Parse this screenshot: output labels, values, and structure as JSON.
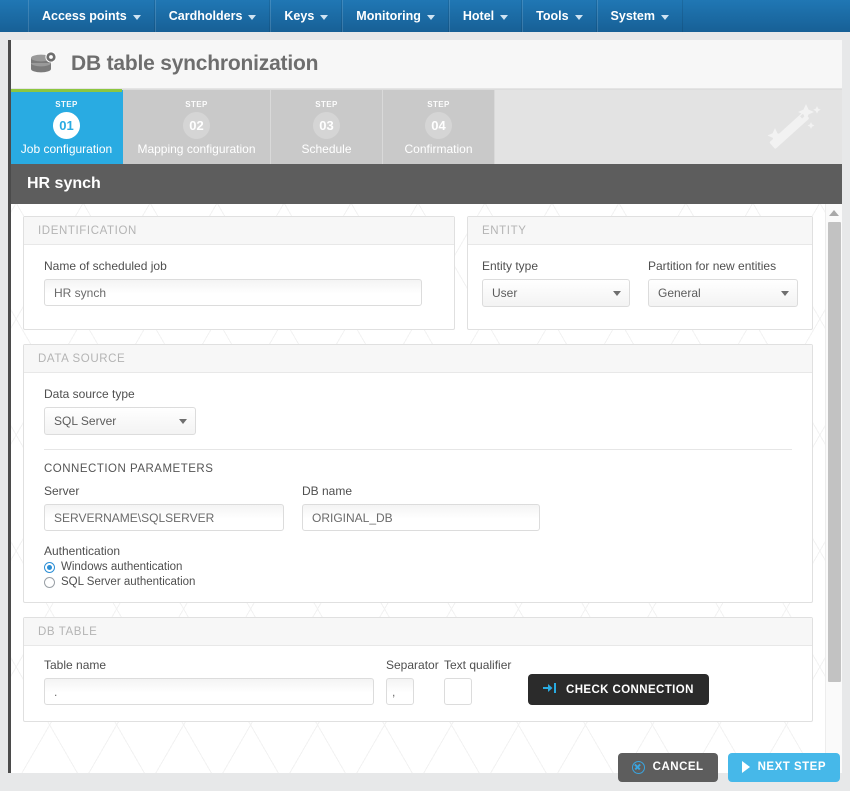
{
  "menubar": {
    "items": [
      {
        "label": "Access points"
      },
      {
        "label": "Cardholders"
      },
      {
        "label": "Keys"
      },
      {
        "label": "Monitoring"
      },
      {
        "label": "Hotel"
      },
      {
        "label": "Tools"
      },
      {
        "label": "System"
      }
    ]
  },
  "page": {
    "title": "DB table synchronization",
    "icon": "database-icon",
    "watermark_icon": "magic-wand-icon"
  },
  "wizard": {
    "step_word": "STEP",
    "steps": [
      {
        "num": "01",
        "name": "Job configuration",
        "active": true
      },
      {
        "num": "02",
        "name": "Mapping configuration",
        "active": false
      },
      {
        "num": "03",
        "name": "Schedule",
        "active": false
      },
      {
        "num": "04",
        "name": "Confirmation",
        "active": false
      }
    ],
    "active_color": "#29abe2",
    "accent_top_color": "#8dc63f"
  },
  "section": {
    "title": "HR synch"
  },
  "identification": {
    "panel_title": "IDENTIFICATION",
    "job_name_label": "Name of scheduled job",
    "job_name_value": "HR synch"
  },
  "entity": {
    "panel_title": "ENTITY",
    "entity_type_label": "Entity type",
    "entity_type_value": "User",
    "partition_label": "Partition for new entities",
    "partition_value": "General"
  },
  "data_source": {
    "panel_title": "DATA SOURCE",
    "type_label": "Data source type",
    "type_value": "SQL Server",
    "connection_params_title": "CONNECTION PARAMETERS",
    "server_label": "Server",
    "server_value": "SERVERNAME\\SQLSERVER",
    "db_name_label": "DB name",
    "db_name_value": "ORIGINAL_DB",
    "authentication_label": "Authentication",
    "auth_options": [
      {
        "label": "Windows authentication",
        "selected": true
      },
      {
        "label": "SQL Server authentication",
        "selected": false
      }
    ]
  },
  "db_table": {
    "panel_title": "DB TABLE",
    "table_name_label": "Table name",
    "table_name_value": ".",
    "separator_label": "Separator",
    "separator_value": ",",
    "text_qualifier_label": "Text qualifier",
    "text_qualifier_value": "",
    "check_connection_label": "CHECK CONNECTION",
    "check_connection_icon": "arrow-into-bar-icon"
  },
  "footer": {
    "cancel_label": "CANCEL",
    "cancel_icon": "circle-x-icon",
    "next_label": "NEXT STEP",
    "next_icon": "chevron-right-icon"
  },
  "scrollbar": {
    "up_icon": "triangle-up-icon",
    "down_icon": "triangle-down-icon"
  }
}
